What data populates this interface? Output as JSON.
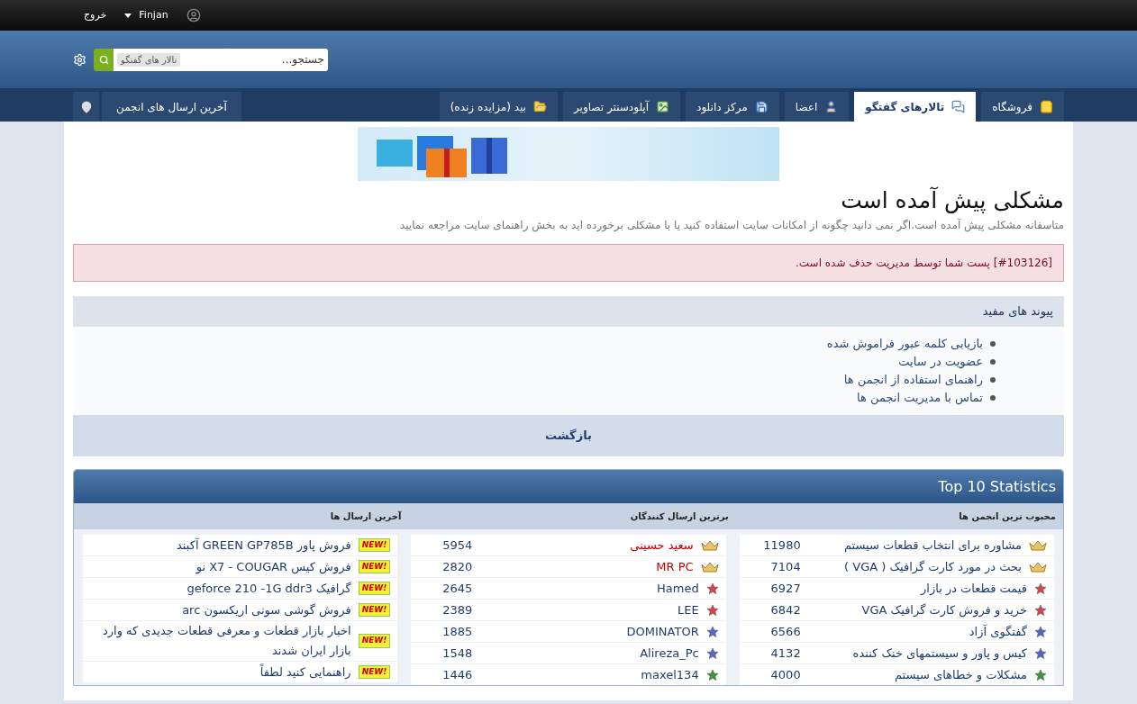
{
  "top_bar": {
    "user": "Finjan",
    "logout": "خروج"
  },
  "search": {
    "placeholder": "جستجو...",
    "scope": "تالار های گفتگو"
  },
  "nav_tabs": [
    {
      "label": "فروشگاه",
      "selected": false
    },
    {
      "label": "تالارهای گفتگو",
      "selected": true
    },
    {
      "label": "اعضا",
      "selected": false
    },
    {
      "label": "مرکز دانلود",
      "selected": false
    },
    {
      "label": "آپلودسنتر تصاویر",
      "selected": false
    },
    {
      "label": "بید (مزایده زنده)",
      "selected": false
    }
  ],
  "nav_side": {
    "label": "آخرین ارسال های انجمن"
  },
  "page": {
    "title": "مشکلی پیش آمده است",
    "description": "متاسفانه مشکلی پیش آمده است.اگر نمی دانید چگونه از امکانات سایت استفاده کنید یا با مشکلی برخورده اید به بخش راهنمای سایت مراجعه نمایید",
    "error": "[#103126] پست شما توسط مدیریت حذف شده است."
  },
  "useful_links": {
    "title": "پیوند های مفید",
    "items": [
      "بازیابی کلمه عبور فراموش شده",
      "عضویت در سایت",
      "راهنمای استفاده از انجمن ها",
      "تماس با مدیریت انجمن ها"
    ],
    "back": "بازگشت"
  },
  "statistics": {
    "title": "Top 10 Statistics",
    "columns": [
      "محبوب ترین انجمن ها",
      "برترین ارسال کنندگان",
      "آخرین ارسال ها"
    ],
    "forums": [
      {
        "kind": "crown",
        "name": "مشاوره برای انتخاب قطعات سیستم",
        "count": "11980"
      },
      {
        "kind": "crown",
        "name": "بحث در مورد کارت گرافیک ( VGA )",
        "count": "7104"
      },
      {
        "kind": "red_star",
        "name": "قیمت قطعات در بازار",
        "count": "6927"
      },
      {
        "kind": "red_star",
        "name": "خرید و فروش کارت گرافیک VGA",
        "count": "6842"
      },
      {
        "kind": "blue_star",
        "name": "گفتگوی آزاد",
        "count": "6566"
      },
      {
        "kind": "blue_star",
        "name": "کیس و پاور و سیستمهای خنک کننده",
        "count": "4132"
      },
      {
        "kind": "green_star",
        "name": "مشکلات و خطاهای سیستم",
        "count": "4000"
      }
    ],
    "posters": [
      {
        "kind": "crown",
        "name": "سعید حسینی",
        "color": "#cc0000",
        "count": "5954"
      },
      {
        "kind": "crown",
        "name": "MR PC",
        "color": "#cc0000",
        "count": "2820"
      },
      {
        "kind": "red_star",
        "name": "Hamed",
        "color": "#1f3d6e",
        "count": "2645"
      },
      {
        "kind": "red_star",
        "name": "LEE",
        "color": "#1f3d6e",
        "count": "2389"
      },
      {
        "kind": "blue_star",
        "name": "DOMINATOR",
        "color": "#1f3d6e",
        "count": "1885"
      },
      {
        "kind": "blue_star",
        "name": "Alireza_Pc",
        "color": "#1f3d6e",
        "count": "1548"
      },
      {
        "kind": "green_star",
        "name": "maxel134",
        "color": "#1f3d6e",
        "count": "1446"
      }
    ],
    "latest": [
      {
        "badge": "NEW!",
        "title": "فروش پاور GREEN GP785B آکبند"
      },
      {
        "badge": "NEW!",
        "title": "فروش کیس X7 - COUGAR نو"
      },
      {
        "badge": "NEW!",
        "title": "گرافیک geforce 210 -1G ddr3"
      },
      {
        "badge": "NEW!",
        "title": "فروش گوشی سونی اریکسون arc"
      },
      {
        "badge": "NEW!",
        "title": "اخبار بازار قطعات و معرفی قطعات جدیدی که وارد بازار ایران شدند"
      },
      {
        "badge": "NEW!",
        "title": "راهنمایی کنید لطفاً"
      }
    ]
  }
}
